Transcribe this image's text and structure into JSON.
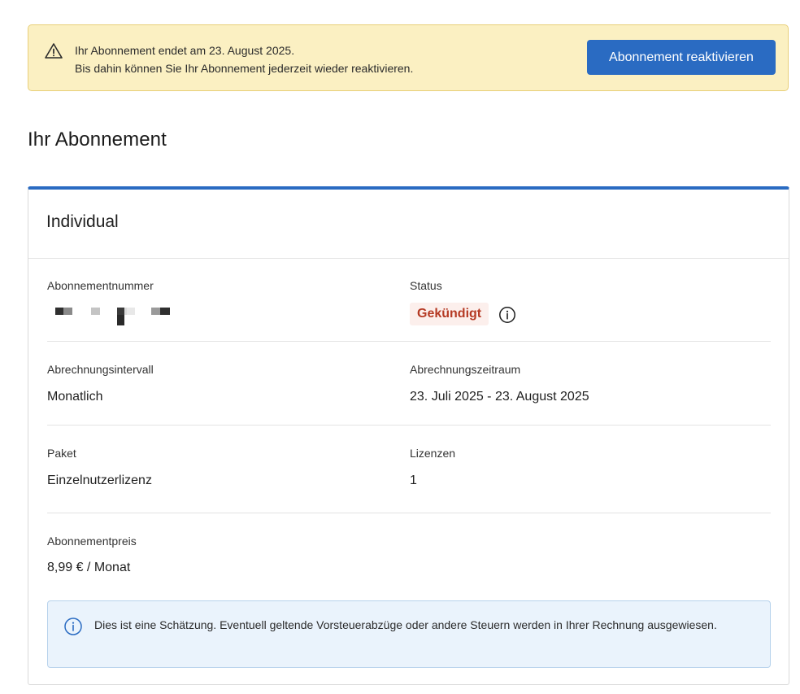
{
  "banner": {
    "icon": "warning-triangle-icon",
    "line1": "Ihr Abonnement endet am 23. August 2025.",
    "line2": "Bis dahin können Sie Ihr Abonnement jederzeit wieder reaktivieren.",
    "button_label": "Abonnement reaktivieren",
    "button_color": "#2a6bc2",
    "background_color": "#fbf0c2"
  },
  "section_title": "Ihr Abonnement",
  "subscription": {
    "plan_name": "Individual",
    "accent_color": "#2a6bc2",
    "fields": {
      "number": {
        "label": "Abonnementnummer"
      },
      "status": {
        "label": "Status",
        "value": "Gekündigt",
        "color": "#b53a24",
        "icon": "info-circle-icon"
      },
      "billing_interval": {
        "label": "Abrechnungsintervall",
        "value": "Monatlich"
      },
      "billing_period": {
        "label": "Abrechnungszeitraum",
        "value": "23. Juli 2025 - 23. August 2025"
      },
      "package": {
        "label": "Paket",
        "value": "Einzelnutzerlizenz"
      },
      "licenses": {
        "label": "Lizenzen",
        "value": "1"
      },
      "price": {
        "label": "Abonnementpreis",
        "value": "8,99 € / Monat"
      }
    },
    "notice": {
      "icon": "info-circle-icon",
      "text": "Dies ist eine Schätzung. Eventuell geltende Vorsteuerabzüge oder andere Steuern werden in Ihrer Rechnung ausgewiesen."
    }
  }
}
